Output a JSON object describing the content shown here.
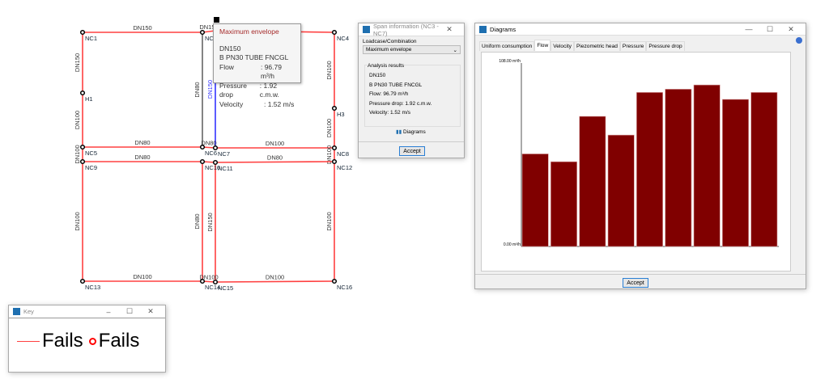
{
  "network": {
    "nodes": [
      "NC1",
      "NC2",
      "NC3",
      "NC4",
      "H1",
      "H3",
      "NC5",
      "NC6",
      "NC7",
      "NC8",
      "NC9",
      "NC10",
      "NC11",
      "NC12",
      "NC13",
      "NC14",
      "NC15",
      "NC16"
    ],
    "pipes": [
      {
        "from": "NC1",
        "to": "NC2",
        "label": "DN150",
        "state": "fails"
      },
      {
        "from": "NC2",
        "to": "NC3",
        "label": "DN150",
        "state": "fails"
      },
      {
        "from": "NC3",
        "to": "NC4",
        "label": "",
        "state": "fails"
      },
      {
        "from": "NC1",
        "to": "H1",
        "label": "DN150",
        "state": "fails"
      },
      {
        "from": "H1",
        "to": "NC5",
        "label": "DN100",
        "state": "fails"
      },
      {
        "from": "NC4",
        "to": "H3",
        "label": "DN100",
        "state": "fails"
      },
      {
        "from": "H3",
        "to": "NC8",
        "label": "DN100",
        "state": "fails"
      },
      {
        "from": "NC2",
        "to": "NC6",
        "label": "DN80",
        "state": "neutral"
      },
      {
        "from": "NC3",
        "to": "NC7",
        "label": "DN150",
        "state": "selected"
      },
      {
        "from": "NC5",
        "to": "NC6",
        "label": "DN80",
        "state": "fails"
      },
      {
        "from": "NC6",
        "to": "NC7",
        "label": "DN80",
        "state": "fails"
      },
      {
        "from": "NC7",
        "to": "NC8",
        "label": "DN100",
        "state": "fails"
      },
      {
        "from": "NC5",
        "to": "NC9",
        "label": "DN100",
        "state": "fails"
      },
      {
        "from": "NC8",
        "to": "NC12",
        "label": "DN100",
        "state": "fails"
      },
      {
        "from": "NC9",
        "to": "NC10",
        "label": "DN80",
        "state": "fails"
      },
      {
        "from": "NC10",
        "to": "NC11",
        "label": "",
        "state": "fails"
      },
      {
        "from": "NC11",
        "to": "NC12",
        "label": "DN80",
        "state": "fails"
      },
      {
        "from": "NC9",
        "to": "NC13",
        "label": "DN100",
        "state": "fails"
      },
      {
        "from": "NC10",
        "to": "NC14",
        "label": "DN80",
        "state": "fails"
      },
      {
        "from": "NC11",
        "to": "NC15",
        "label": "DN150",
        "state": "fails"
      },
      {
        "from": "NC12",
        "to": "NC16",
        "label": "DN100",
        "state": "fails"
      },
      {
        "from": "NC13",
        "to": "NC14",
        "label": "DN100",
        "state": "fails"
      },
      {
        "from": "NC14",
        "to": "NC15",
        "label": "DN100",
        "state": "fails"
      },
      {
        "from": "NC15",
        "to": "NC16",
        "label": "DN100",
        "state": "fails"
      }
    ],
    "colors": {
      "fails": "#ff4040",
      "neutral": "#666666",
      "selected": "#3333ff"
    }
  },
  "tooltip": {
    "title": "Maximum envelope",
    "dn": "DN150",
    "material": "B PN30 TUBE FNCGL",
    "rows": [
      {
        "k": "Flow",
        "v": ": 96.79 m³/h"
      },
      {
        "k": "Pressure drop",
        "v": ": 1.92 c.m.w."
      },
      {
        "k": "Velocity",
        "v": ": 1.52 m/s"
      }
    ]
  },
  "span": {
    "title": "Span information (NC3 - NC7)",
    "loadcase_label": "Loadcase/Combination",
    "loadcase_value": "Maximum envelope",
    "group": "Analysis results",
    "lines": [
      "DN150",
      "B PN30 TUBE FNCGL",
      "Flow: 96.79 m³/h",
      "Pressure drop: 1.92 c.m.w.",
      "Velocity: 1.52 m/s"
    ],
    "diagrams": "Diagrams",
    "accept": "Accept"
  },
  "diagrams": {
    "title": "Diagrams",
    "tabs": [
      "Uniform consumption",
      "Flow",
      "Velocity",
      "Piezometric head",
      "Pressure",
      "Pressure drop"
    ],
    "active_tab": "Flow",
    "accept": "Accept"
  },
  "chart_data": {
    "type": "bar",
    "ylim": [
      0,
      108
    ],
    "ymax_label": "108.00 m³/h",
    "ymin_label": "0.00 m³/h",
    "values": [
      54.5,
      49.9,
      76.6,
      65.6,
      90.7,
      92.6,
      95.1,
      86.6,
      90.7
    ],
    "color": "#800000"
  },
  "key": {
    "title": "Key",
    "line_label": "Fails",
    "node_label": "Fails",
    "color": "#ff0000"
  }
}
